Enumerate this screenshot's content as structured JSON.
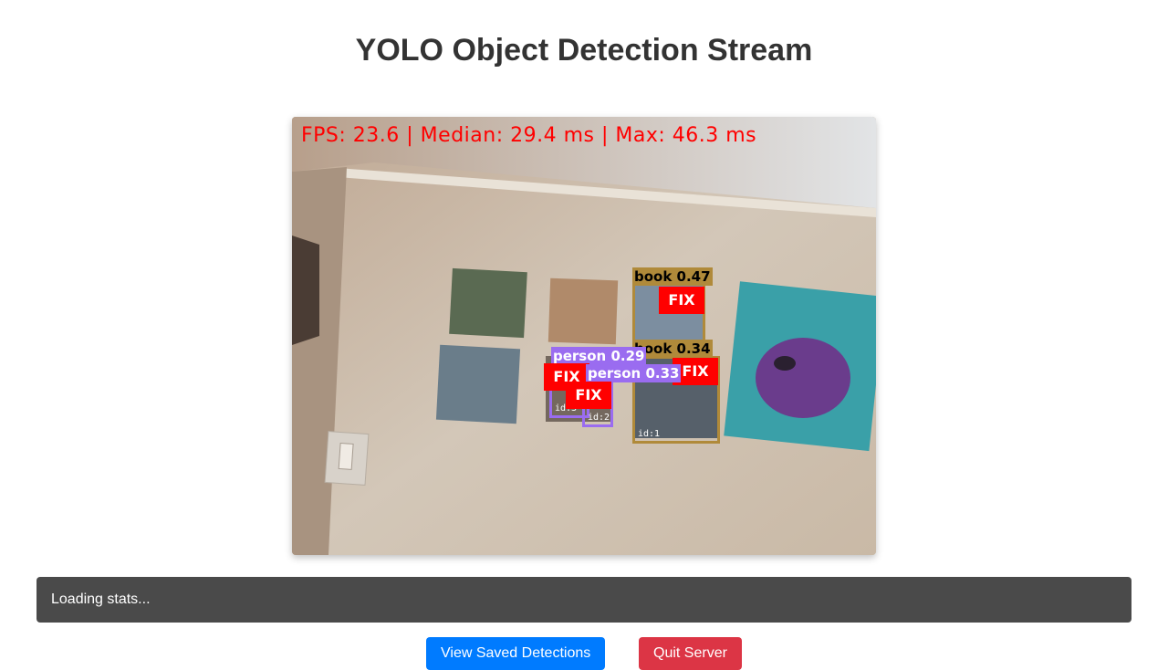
{
  "page": {
    "title": "YOLO Object Detection Stream"
  },
  "stream": {
    "overlay_text": "FPS: 23.6 | Median: 29.4 ms | Max: 46.3 ms",
    "detections": [
      {
        "label": "book 0.47",
        "tag": "FIX",
        "id": "",
        "color": "#b08a3a"
      },
      {
        "label": "book 0.34",
        "tag": "FIX",
        "id": "id:1",
        "color": "#b08a3a"
      },
      {
        "label": "person 0.29",
        "tag": "FIX",
        "id": "id:3",
        "color": "#9a6cf0"
      },
      {
        "label": "person 0.33",
        "tag": "FIX",
        "id": "id:2",
        "color": "#9a6cf0"
      }
    ]
  },
  "stats": {
    "text": "Loading stats..."
  },
  "buttons": {
    "saved": "View Saved Detections",
    "quit": "Quit Server"
  },
  "colors": {
    "primary": "#007bff",
    "danger": "#dc3545",
    "stats_bg": "#4a4a4a",
    "title": "#333333",
    "overlay": "#ff0000"
  }
}
